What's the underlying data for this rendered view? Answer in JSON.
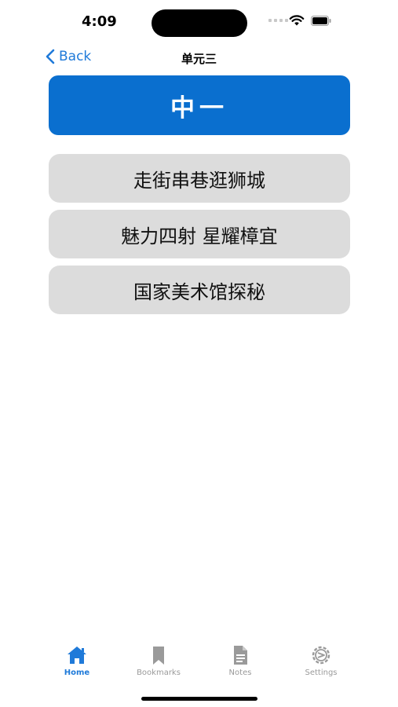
{
  "status_bar": {
    "time": "4:09"
  },
  "nav": {
    "back_label": "Back",
    "title": "单元三"
  },
  "header": {
    "title": "中一"
  },
  "lessons": [
    {
      "label": "走街串巷逛狮城"
    },
    {
      "label": "魅力四射 星耀樟宜"
    },
    {
      "label": "国家美术馆探秘"
    }
  ],
  "tabs": [
    {
      "label": "Home",
      "icon": "home-icon",
      "active": true
    },
    {
      "label": "Bookmarks",
      "icon": "bookmark-icon",
      "active": false
    },
    {
      "label": "Notes",
      "icon": "document-icon",
      "active": false
    },
    {
      "label": "Settings",
      "icon": "gear-icon",
      "active": false
    }
  ],
  "colors": {
    "accent": "#1f7ad9",
    "header_bg": "#0a6fcf",
    "item_bg": "#dcdcdc",
    "inactive": "#9a9a9a"
  }
}
